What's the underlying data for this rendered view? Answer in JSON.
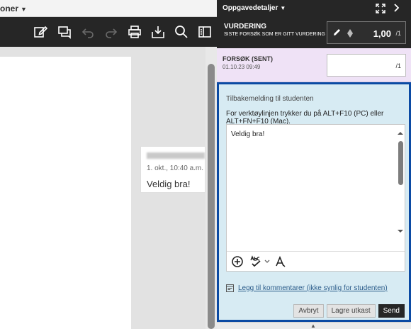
{
  "left": {
    "menu_label": "oner",
    "comment": {
      "date": "1. okt., 10:40 a.m.",
      "text": "Veldig bra!"
    }
  },
  "panel": {
    "title": "Oppgavedetaljer",
    "grade": {
      "label": "VURDERING",
      "sublabel": "SISTE FORSØK SOM ER GITT VURDERING",
      "value": "1,00",
      "denominator": "/1"
    },
    "attempt": {
      "label": "FORSØK (SENT)",
      "date": "01.10.23 09:49",
      "denominator": "/1"
    },
    "feedback": {
      "title": "Tilbakemelding til studenten",
      "hint": "For verktøylinjen trykker du på ALT+F10 (PC) eller ALT+FN+F10 (Mac).",
      "content": "Veldig bra!",
      "link": "Legg til kommentarer (ikke synlig for studenten)"
    },
    "buttons": {
      "cancel": "Avbryt",
      "save_draft": "Lagre utkast",
      "send": "Send"
    }
  },
  "colors": {
    "dark": "#262626",
    "attempt_bg": "#efe2f6",
    "feedback_bg": "#d7ebf3",
    "focus_border": "#0b4aa3",
    "link": "#2b5c8a"
  }
}
